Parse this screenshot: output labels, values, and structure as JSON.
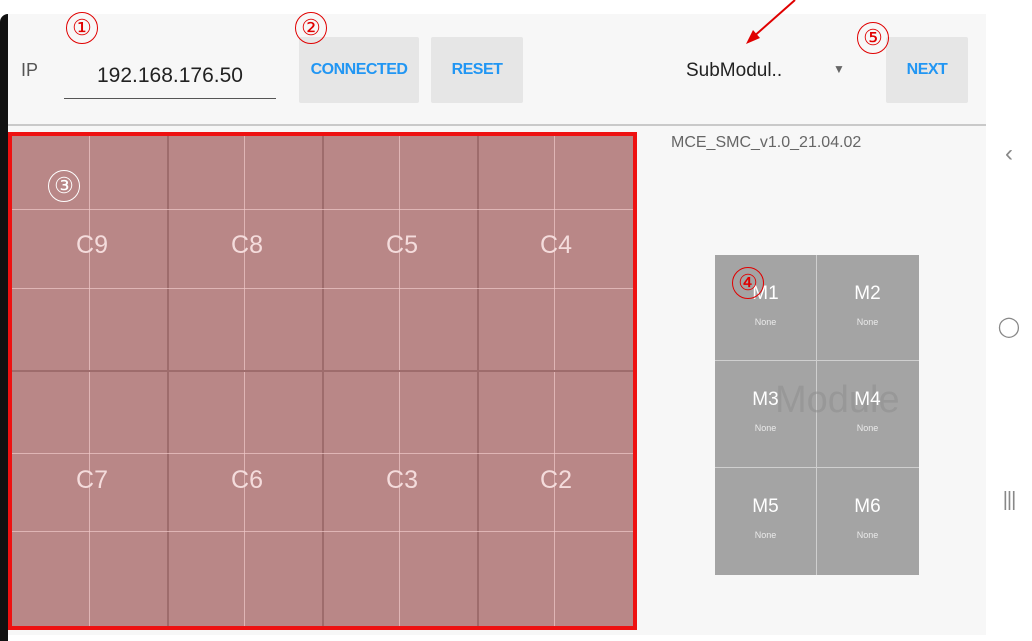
{
  "ip": {
    "label": "IP",
    "value": "192.168.176.50"
  },
  "buttons": {
    "connected": "CONNECTED",
    "reset": "RESET",
    "next": "NEXT"
  },
  "dropdown": {
    "selected": "SubModul.."
  },
  "version": "MCE_SMC_v1.0_21.04.02",
  "grid": {
    "row1": [
      "C9",
      "C8",
      "C5",
      "C4"
    ],
    "row2": [
      "C7",
      "C6",
      "C3",
      "C2"
    ]
  },
  "module": {
    "watermark": "Module",
    "cells": [
      {
        "name": "M1",
        "state": "None"
      },
      {
        "name": "M2",
        "state": "None"
      },
      {
        "name": "M3",
        "state": "None"
      },
      {
        "name": "M4",
        "state": "None"
      },
      {
        "name": "M5",
        "state": "None"
      },
      {
        "name": "M6",
        "state": "None"
      }
    ]
  },
  "markers": [
    "①",
    "②",
    "③",
    "④",
    "⑤"
  ],
  "colors": {
    "accent": "#2196f3",
    "highlight": "#ee1111",
    "grid_fill": "#b98787",
    "module_fill": "#a4a4a4"
  },
  "nav_icons": [
    "back-icon",
    "home-icon",
    "recents-icon"
  ]
}
